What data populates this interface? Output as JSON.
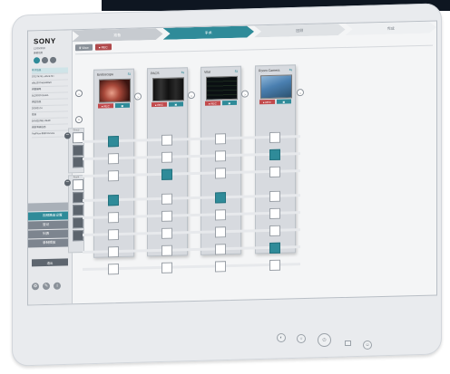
{
  "brand": "SONY",
  "sidebar": {
    "info_lines": [
      "12/30/2020",
      "患者姓名"
    ],
    "buttons": [
      "i",
      "🔒",
      "+"
    ],
    "patient_rows": [
      "手术信息",
      "STDT4741-xdbc47d+",
      "a8a13974ab4fdfa6",
      "病案编号",
      "BL29930-SARA",
      "病区信息",
      "20093574",
      "性别",
      "BYM2D0B1-8E4E",
      "病历号码信息",
      "PatiFlow-8869 Device"
    ],
    "nav_header": "",
    "nav_items": [
      "视频路由设置",
      "登记",
      "列表",
      "录制播放"
    ],
    "exit_label": "退出",
    "bottom_icons": [
      "gear-icon",
      "wrench-icon",
      "info-icon"
    ]
  },
  "stepper": {
    "steps": [
      "准备",
      "手术",
      "回顾",
      "完成"
    ],
    "active_index": 1
  },
  "toolbar": {
    "view_label": "Ⅲ View",
    "rec_label": "● REC"
  },
  "devices": [
    {
      "name": "Endoscope"
    },
    {
      "name": "PACS"
    },
    {
      "name": "Vital"
    },
    {
      "name": "Room Camera"
    }
  ],
  "card_buttons": {
    "red": "● REC",
    "teal": "▣"
  },
  "groups": [
    {
      "label": "Group"
    },
    {
      "label": "Room"
    }
  ],
  "routing": {
    "rows": 8,
    "selected": [
      [
        0
      ],
      [
        3
      ],
      [
        1
      ],
      [
        2
      ],
      [
        5
      ],
      [
        4
      ],
      [
        3
      ],
      [
        6
      ]
    ]
  },
  "colors": {
    "accent": "#2f8b99",
    "record": "#c24a4c"
  }
}
